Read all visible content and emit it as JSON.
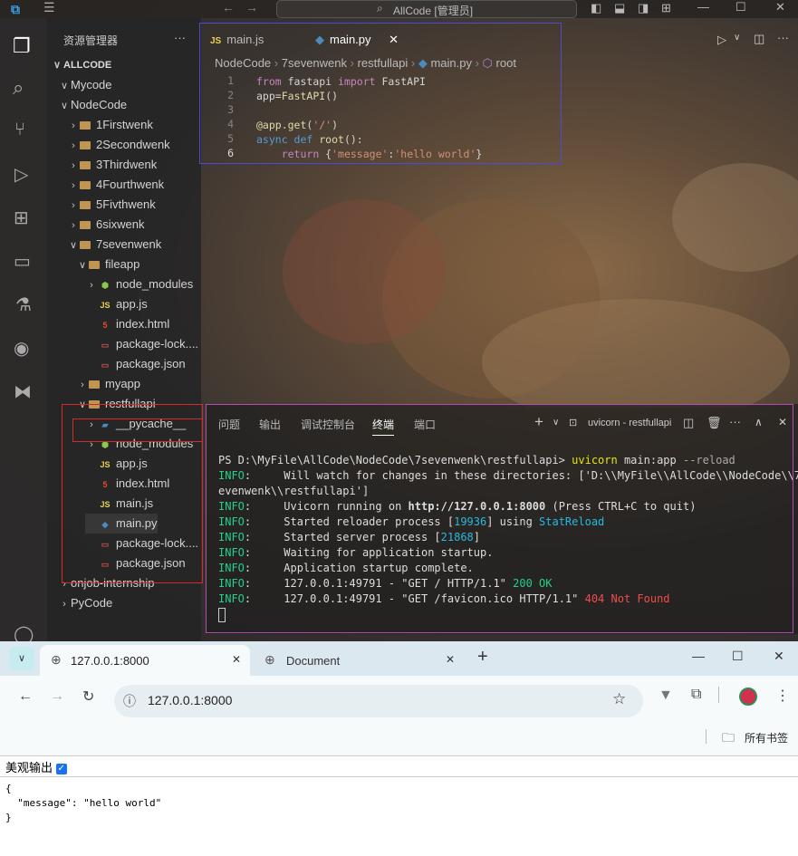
{
  "vscode": {
    "title": "AllCode [管理员]",
    "sidebar": {
      "header": "资源管理器",
      "more": "···",
      "root": "ALLCODE",
      "items": [
        {
          "label": "Mycode",
          "kind": "folder-open"
        },
        {
          "label": "NodeCode",
          "kind": "folder-open"
        },
        {
          "label": "1Firstwenk",
          "kind": "folder"
        },
        {
          "label": "2Secondwenk",
          "kind": "folder"
        },
        {
          "label": "3Thirdwenk",
          "kind": "folder"
        },
        {
          "label": "4Fourthwenk",
          "kind": "folder"
        },
        {
          "label": "5Fivthwenk",
          "kind": "folder"
        },
        {
          "label": "6sixwenk",
          "kind": "folder"
        },
        {
          "label": "7sevenwenk",
          "kind": "folder-open"
        },
        {
          "label": "fileapp",
          "kind": "folder-open"
        },
        {
          "label": "node_modules",
          "kind": "node-folder"
        },
        {
          "label": "app.js",
          "kind": "js"
        },
        {
          "label": "index.html",
          "kind": "html"
        },
        {
          "label": "package-lock....",
          "kind": "json"
        },
        {
          "label": "package.json",
          "kind": "json"
        },
        {
          "label": "myapp",
          "kind": "folder"
        },
        {
          "label": "restfullapi",
          "kind": "folder-open"
        },
        {
          "label": "__pycache__",
          "kind": "py-folder"
        },
        {
          "label": "node_modules",
          "kind": "node-folder"
        },
        {
          "label": "app.js",
          "kind": "js"
        },
        {
          "label": "index.html",
          "kind": "html"
        },
        {
          "label": "main.js",
          "kind": "js"
        },
        {
          "label": "main.py",
          "kind": "py"
        },
        {
          "label": "package-lock....",
          "kind": "json"
        },
        {
          "label": "package.json",
          "kind": "json"
        },
        {
          "label": "onjob-internship",
          "kind": "folder"
        },
        {
          "label": "PyCode",
          "kind": "folder"
        }
      ]
    },
    "tabs": [
      {
        "label": "main.js",
        "icon": "JS"
      },
      {
        "label": "main.py",
        "icon": "python-icon",
        "close": "✕"
      }
    ],
    "breadcrumb": [
      "NodeCode",
      "7sevenwenk",
      "restfullapi",
      "main.py",
      "root"
    ],
    "code": {
      "line_numbers": [
        "1",
        "2",
        "3",
        "4",
        "5",
        "6"
      ],
      "l1": {
        "a": "from",
        "b": " fastapi ",
        "c": "import",
        "d": " FastAPI"
      },
      "l2": {
        "a": "app",
        "b": "=",
        "c": "FastAPI",
        "d": "()"
      },
      "l4": {
        "a": "@app.get",
        "b": "(",
        "c": "'/'",
        "d": ")"
      },
      "l5": {
        "a": "async",
        "b": " def ",
        "c": "root",
        "d": "():"
      },
      "l6": {
        "a": "return",
        "b": " {",
        "c": "'message'",
        "d": ":",
        "e": "'hello world'",
        "f": "}"
      }
    },
    "panel": {
      "tabs": [
        "问题",
        "输出",
        "调试控制台",
        "终端",
        "端口"
      ],
      "active_tab": "终端",
      "add": "+",
      "terminal_name": "uvicorn - restfullapi",
      "lines": {
        "l1": {
          "prompt": "PS D:\\MyFile\\AllCode\\NodeCode\\7sevenwenk\\restfullapi> ",
          "cmd": "uvicorn",
          "rest": " main:app ",
          "flag": "--reload"
        },
        "l2": {
          "tag": "INFO",
          "text": ":     Will watch for changes in these directories: ['D:\\\\MyFile\\\\AllCode\\\\NodeCode\\\\7s"
        },
        "l3": {
          "text": "evenwenk\\\\restfullapi']"
        },
        "l4": {
          "tag": "INFO",
          "text": ":     Uvicorn running on ",
          "url": "http://127.0.0.1:8000",
          "rest": " (Press CTRL+C to quit)"
        },
        "l5": {
          "tag": "INFO",
          "text": ":     Started reloader process [",
          "num": "19936",
          "mid": "] using ",
          "name": "StatReload"
        },
        "l6": {
          "tag": "INFO",
          "text": ":     Started server process [",
          "num": "21868",
          "end": "]"
        },
        "l7": {
          "tag": "INFO",
          "text": ":     Waiting for application startup."
        },
        "l8": {
          "tag": "INFO",
          "text": ":     Application startup complete."
        },
        "l9": {
          "tag": "INFO",
          "text": ":     127.0.0.1:49791 - \"GET / HTTP/1.1\" ",
          "status": "200 OK"
        },
        "l10": {
          "tag": "INFO",
          "text": ":     127.0.0.1:49791 - \"GET /favicon.ico HTTP/1.1\" ",
          "status": "404 Not Found"
        }
      }
    }
  },
  "browser": {
    "tabs": [
      {
        "label": "127.0.0.1:8000",
        "close": "✕"
      },
      {
        "label": "Document",
        "close": "✕"
      }
    ],
    "new_tab": "+",
    "url": "127.0.0.1:8000",
    "bookmarks_label": "所有书签",
    "pretty_print_label": "美观输出",
    "pretty_print_checked": true,
    "json_lines": [
      "{",
      "  \"message\": \"hello world\"",
      "}"
    ]
  }
}
